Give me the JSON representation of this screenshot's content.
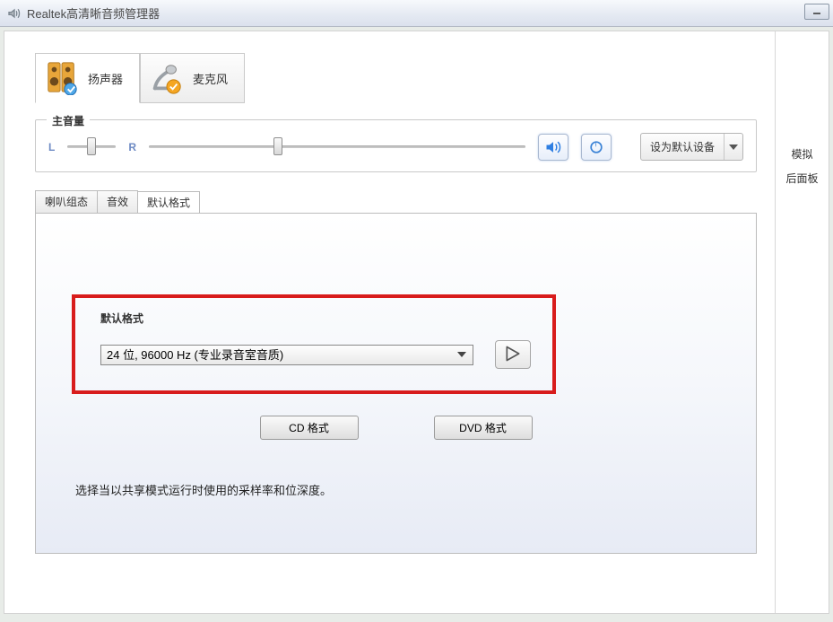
{
  "window": {
    "title": "Realtek高清晰音频管理器"
  },
  "device_tabs": {
    "speakers": "扬声器",
    "microphone": "麦克风"
  },
  "volume": {
    "legend": "主音量",
    "left_label": "L",
    "right_label": "R",
    "set_default": "设为默认设备"
  },
  "inner_tabs": {
    "speaker_config": "喇叭组态",
    "sound_effects": "音效",
    "default_format": "默认格式"
  },
  "default_format": {
    "title": "默认格式",
    "selected_option": "24 位, 96000 Hz (专业录音室音质)",
    "cd_btn": "CD 格式",
    "dvd_btn": "DVD 格式",
    "desc": "选择当以共享模式运行时使用的采样率和位深度。"
  },
  "side": {
    "simulate": "模拟",
    "rear_panel": "后面板"
  }
}
